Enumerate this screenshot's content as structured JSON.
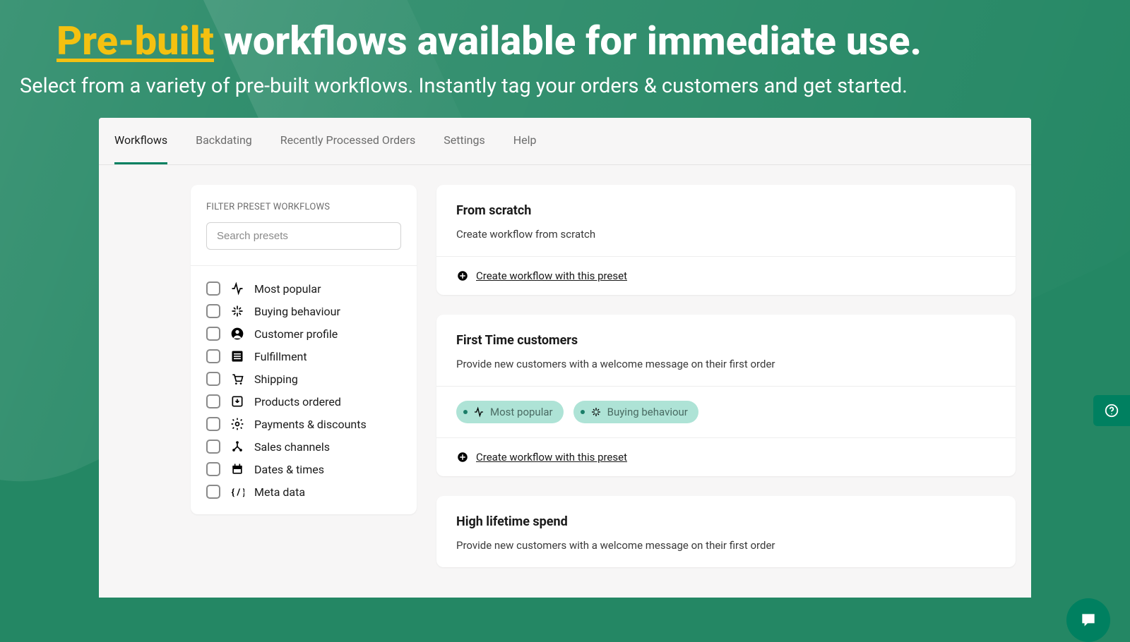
{
  "hero": {
    "highlight": "Pre-built",
    "rest": " workflows available for immediate use.",
    "subtitle": "Select from a variety of pre-built workflows. Instantly tag your orders & customers and get started."
  },
  "tabs": [
    "Workflows",
    "Backdating",
    "Recently Processed Orders",
    "Settings",
    "Help"
  ],
  "activeTab": 0,
  "sidebar": {
    "title": "FILTER PRESET WORKFLOWS",
    "search_placeholder": "Search presets",
    "filters": [
      {
        "icon": "activity",
        "label": "Most popular"
      },
      {
        "icon": "sparkle",
        "label": "Buying behaviour"
      },
      {
        "icon": "user",
        "label": "Customer profile"
      },
      {
        "icon": "list",
        "label": "Fulfillment"
      },
      {
        "icon": "cart",
        "label": "Shipping"
      },
      {
        "icon": "download-box",
        "label": "Products ordered"
      },
      {
        "icon": "gear",
        "label": "Payments & discounts"
      },
      {
        "icon": "channels",
        "label": "Sales channels"
      },
      {
        "icon": "calendar",
        "label": "Dates & times"
      },
      {
        "icon": "code",
        "label": "Meta data"
      }
    ]
  },
  "cards": [
    {
      "title": "From scratch",
      "desc": "Create workflow from scratch",
      "action": "Create workflow with this preset"
    },
    {
      "title": "First Time customers",
      "desc": "Provide new customers with a welcome message on their first order",
      "tags": [
        {
          "icon": "activity",
          "label": "Most popular"
        },
        {
          "icon": "sparkle",
          "label": "Buying behaviour"
        }
      ],
      "action": "Create workflow with this preset"
    },
    {
      "title": "High lifetime spend",
      "desc": "Provide new customers with a welcome message on their first order"
    }
  ]
}
